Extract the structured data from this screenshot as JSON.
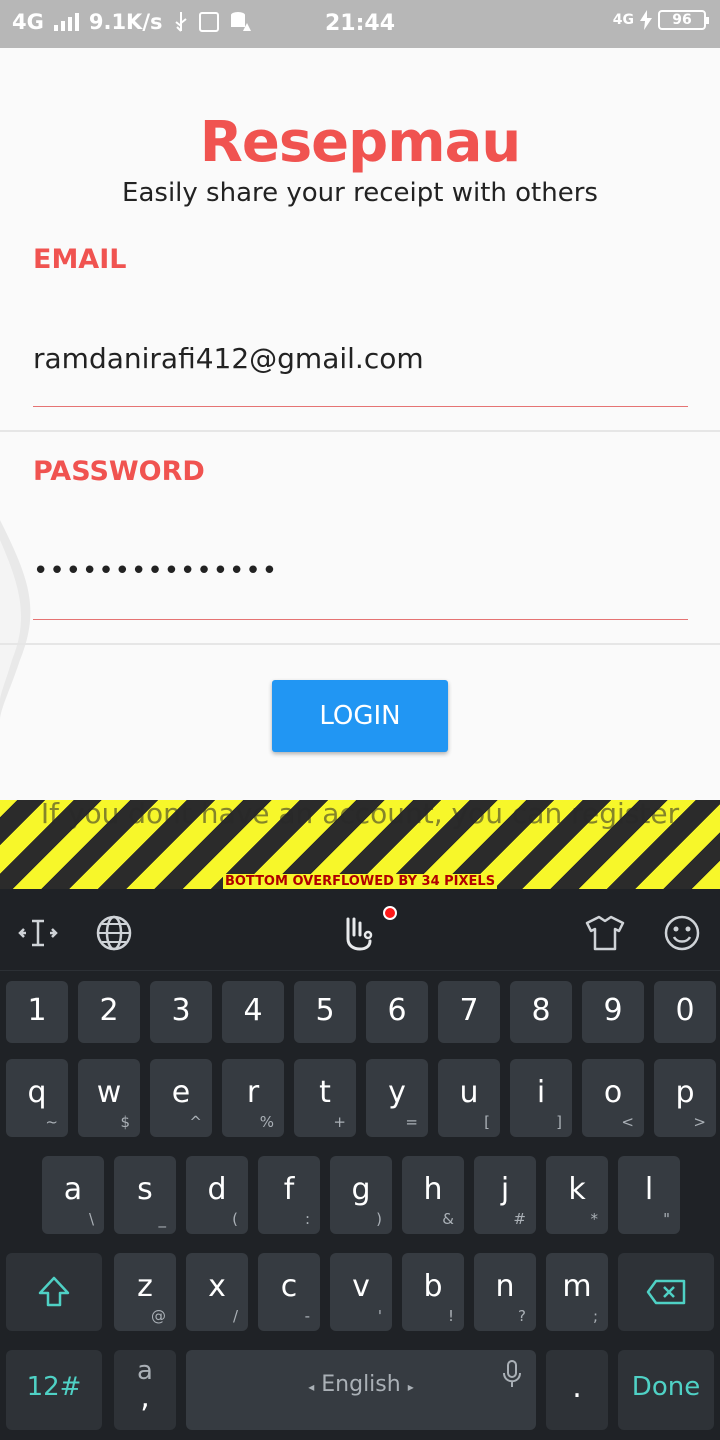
{
  "status_bar": {
    "network": "4G",
    "speed": "9.1K/s",
    "time": "21:44",
    "net_right": "4G",
    "battery": "96"
  },
  "app": {
    "title": "Resepmau",
    "subtitle": "Easily share your receipt with others",
    "email_label": "EMAIL",
    "email_value": "ramdanirafi412@gmail.com",
    "password_label": "PASSWORD",
    "password_value": "•••••••••••••••",
    "login_label": "LOGIN",
    "register_text": "If you dont have an account, you can register",
    "overflow_warning": "BOTTOM OVERFLOWED BY 34 PIXELS",
    "accent_color": "#f05350",
    "button_color": "#2196f3"
  },
  "keyboard": {
    "row_numbers": [
      "1",
      "2",
      "3",
      "4",
      "5",
      "6",
      "7",
      "8",
      "9",
      "0"
    ],
    "row1": [
      {
        "k": "q",
        "s": "~"
      },
      {
        "k": "w",
        "s": "$"
      },
      {
        "k": "e",
        "s": "^"
      },
      {
        "k": "r",
        "s": "%"
      },
      {
        "k": "t",
        "s": "+"
      },
      {
        "k": "y",
        "s": "="
      },
      {
        "k": "u",
        "s": "["
      },
      {
        "k": "i",
        "s": "]"
      },
      {
        "k": "o",
        "s": "<"
      },
      {
        "k": "p",
        "s": ">"
      }
    ],
    "row2": [
      {
        "k": "a",
        "s": "\\"
      },
      {
        "k": "s",
        "s": "_"
      },
      {
        "k": "d",
        "s": "("
      },
      {
        "k": "f",
        "s": ":"
      },
      {
        "k": "g",
        "s": ")"
      },
      {
        "k": "h",
        "s": "&"
      },
      {
        "k": "j",
        "s": "#"
      },
      {
        "k": "k",
        "s": "*"
      },
      {
        "k": "l",
        "s": "\""
      }
    ],
    "row3": [
      {
        "k": "z",
        "s": "@"
      },
      {
        "k": "x",
        "s": "/"
      },
      {
        "k": "c",
        "s": "-"
      },
      {
        "k": "v",
        "s": "'"
      },
      {
        "k": "b",
        "s": "!"
      },
      {
        "k": "n",
        "s": "?"
      },
      {
        "k": "m",
        "s": ";"
      }
    ],
    "symbols_key": "12#",
    "comma_key_top": "a",
    "comma_key_bottom": ",",
    "space_label": "English",
    "period_key": ".",
    "done_key": "Done"
  }
}
